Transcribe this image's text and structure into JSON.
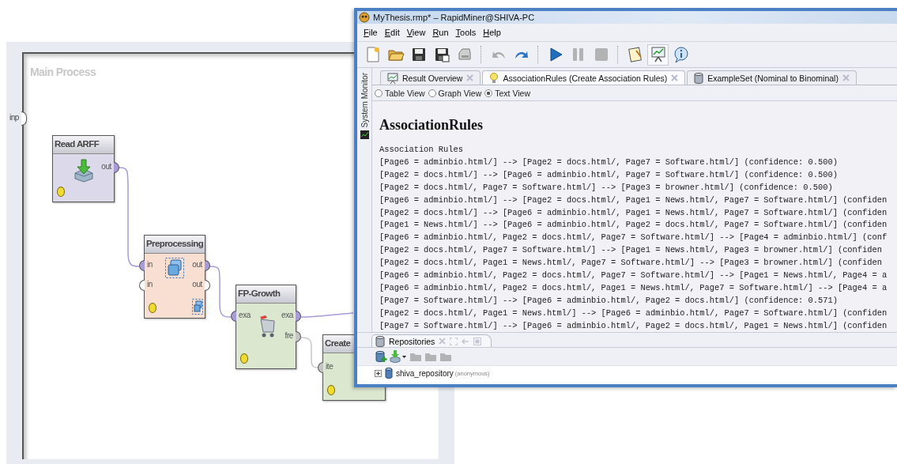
{
  "process": {
    "title": "Main Process",
    "input_port": "inp",
    "nodes": [
      {
        "name": "Read ARFF",
        "kind": "read",
        "color": "#dcd9ea",
        "outputs": [
          {
            "label": "out",
            "color": "#a99ad8"
          }
        ]
      },
      {
        "name": "Preprocessing",
        "kind": "subprocess",
        "color": "#f9ded2",
        "inputs": [
          {
            "label": "in",
            "color": "#a99ad8"
          },
          {
            "label": "in",
            "color": "#ffffff"
          }
        ],
        "outputs": [
          {
            "label": "out",
            "color": "#a99ad8"
          },
          {
            "label": "out",
            "color": "#ffffff"
          }
        ]
      },
      {
        "name": "FP-Growth",
        "kind": "cart",
        "color": "#dbe7cf",
        "inputs": [
          {
            "label": "exa",
            "color": "#a99ad8"
          }
        ],
        "outputs": [
          {
            "label": "exa",
            "color": "#a99ad8"
          },
          {
            "label": "fre",
            "color": "#c4c4c4"
          }
        ]
      },
      {
        "name": "Create",
        "kind": "none",
        "color": "#dbe7cf",
        "inputs": [
          {
            "label": "ite",
            "color": "#c4c4c4"
          }
        ]
      }
    ]
  },
  "window": {
    "title": "MyThesis.rmp* – RapidMiner@SHIVA-PC",
    "menu": [
      "File",
      "Edit",
      "View",
      "Run",
      "Tools",
      "Help"
    ],
    "toolbar": [
      {
        "kind": "new",
        "disabled": false,
        "selected": false
      },
      {
        "kind": "open",
        "disabled": false,
        "selected": false
      },
      {
        "kind": "save",
        "disabled": false,
        "selected": false
      },
      {
        "kind": "save-as",
        "disabled": false,
        "selected": false
      },
      {
        "kind": "print",
        "disabled": false,
        "selected": false
      },
      {
        "kind": "undo",
        "disabled": true,
        "selected": false
      },
      {
        "kind": "redo",
        "disabled": false,
        "selected": false
      },
      {
        "kind": "run",
        "disabled": false,
        "selected": false
      },
      {
        "kind": "pause",
        "disabled": true,
        "selected": false
      },
      {
        "kind": "stop",
        "disabled": true,
        "selected": false
      },
      {
        "kind": "notes",
        "disabled": false,
        "selected": false
      },
      {
        "kind": "results",
        "disabled": false,
        "selected": true
      },
      {
        "kind": "info",
        "disabled": false,
        "selected": false
      }
    ],
    "side_tab": "System Monitor",
    "tabs": [
      {
        "label": "Result Overview",
        "kind": "chart",
        "selected": false
      },
      {
        "label": "AssociationRules (Create Association Rules)",
        "kind": "bulb",
        "selected": true
      },
      {
        "label": "ExampleSet (Nominal to Binominal)",
        "kind": "database",
        "selected": false
      }
    ],
    "views": [
      {
        "label": "Table View",
        "selected": false
      },
      {
        "label": "Graph View",
        "selected": false
      },
      {
        "label": "Text View",
        "selected": true
      }
    ],
    "result": {
      "heading": "AssociationRules",
      "subheading": "Association Rules",
      "lines": [
        "[Page6 = adminbio.html/] --> [Page2 = docs.html/, Page7 = Software.html/] (confidence: 0.500)",
        "[Page2 = docs.html/] --> [Page6 = adminbio.html/, Page7 = Software.html/] (confidence: 0.500)",
        "[Page2 = docs.html/, Page7 = Software.html/] --> [Page3 = browner.html/] (confidence: 0.500)",
        "[Page6 = adminbio.html/] --> [Page2 = docs.html/, Page1 = News.html/, Page7 = Software.html/] (confiden",
        "[Page2 = docs.html/] --> [Page6 = adminbio.html/, Page1 = News.html/, Page7 = Software.html/] (confiden",
        "[Page1 = News.html/] --> [Page6 = adminbio.html/, Page2 = docs.html/, Page7 = Software.html/] (confiden",
        "[Page6 = adminbio.html/, Page2 = docs.html/, Page7 = Software.html/] --> [Page4 = adminbio.html/] (conf",
        "[Page2 = docs.html/, Page7 = Software.html/] --> [Page1 = News.html/, Page3 = browner.html/] (confiden",
        "[Page2 = docs.html/, Page1 = News.html/, Page7 = Software.html/] --> [Page3 = browner.html/] (confiden",
        "[Page6 = adminbio.html/, Page2 = docs.html/, Page7 = Software.html/] --> [Page1 = News.html/, Page4 = a",
        "[Page6 = adminbio.html/, Page2 = docs.html/, Page1 = News.html/, Page7 = Software.html/] --> [Page4 = a",
        "[Page7 = Software.html/] --> [Page6 = adminbio.html/, Page2 = docs.html/] (confidence: 0.571)",
        "[Page2 = docs.html/, Page1 = News.html/] --> [Page6 = adminbio.html/, Page7 = Software.html/] (confiden",
        "[Page7 = Software.html/] --> [Page6 = adminbio.html/, Page2 = docs.html/, Page1 = News.html/] (confiden"
      ]
    },
    "repositories": {
      "tab": "Repositories",
      "toolbar": [
        {
          "kind": "add",
          "disabled": false
        },
        {
          "kind": "import",
          "disabled": false
        },
        {
          "kind": "folder",
          "disabled": true
        },
        {
          "kind": "folder",
          "disabled": true
        },
        {
          "kind": "folder",
          "disabled": true
        }
      ],
      "tree": [
        {
          "name": "shiva_repository",
          "note": "(anonymous)",
          "expanded": false
        }
      ]
    }
  }
}
